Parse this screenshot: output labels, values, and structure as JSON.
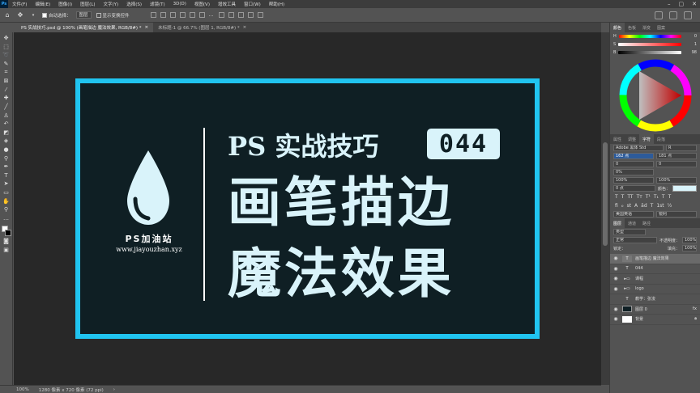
{
  "app": {
    "logo": "Ps"
  },
  "menu": [
    "文件(F)",
    "编辑(E)",
    "图像(I)",
    "图层(L)",
    "文字(Y)",
    "选择(S)",
    "滤镜(T)",
    "3D(D)",
    "视图(V)",
    "增效工具",
    "窗口(W)",
    "帮助(H)"
  ],
  "options": {
    "auto_select_label": "自动选择：",
    "auto_select_value": "图层",
    "show_transform_label": "显示变换控件"
  },
  "tabs": [
    {
      "label": "PS 实战技巧.psd @ 100% (画笔描边 魔法效果, RGB/8#) *",
      "close": "×"
    },
    {
      "label": "未标题-1 @ 66.7% (图层 1, RGB/8#) *",
      "close": "×"
    }
  ],
  "artwork": {
    "brand_name": "PS加油站",
    "brand_url": "www.jiayouzhan.xyz",
    "title_line1": "PS 实战技巧",
    "episode_number": "044",
    "title_line2": "画笔描边",
    "title_line3": "魔法效果",
    "colors": {
      "background": "#0f1f24",
      "frame": "#20c4f0",
      "text": "#d9f3fa"
    }
  },
  "status": {
    "zoom": "100%",
    "doc_size": "1280 像素 x 720 像素 (72 ppi)"
  },
  "color_panel": {
    "tabs": [
      "颜色",
      "色板",
      "渐变",
      "图案"
    ],
    "sliders": [
      {
        "label": "H",
        "value": "0"
      },
      {
        "label": "S",
        "value": "1"
      },
      {
        "label": "B",
        "value": "98"
      }
    ]
  },
  "props_tabs": [
    "属性",
    "调整",
    "字符",
    "段落"
  ],
  "character": {
    "font": "Adobe 黑体 Std",
    "style": "R",
    "size": "162 点",
    "leading": "181 点",
    "kerning": "0",
    "tracking": "0",
    "percent": "0%",
    "vscale": "100%",
    "hscale": "100%",
    "baseline": "0 点",
    "color_label": "颜色：",
    "lang": "美国英语",
    "aa": "锐利",
    "type_buttons": [
      "T",
      "T",
      "TT",
      "Tт",
      "T¹",
      "T₁",
      "T",
      "T"
    ],
    "otf_buttons": [
      "fi",
      "ℴ",
      "st",
      "A",
      "ād",
      "T",
      "1st",
      "½"
    ]
  },
  "layers_panel": {
    "tabs": [
      "图层",
      "通道",
      "路径"
    ],
    "filter": "类型",
    "blend": "正常",
    "opacity_label": "不透明度：",
    "opacity": "100%",
    "lock_label": "锁定：",
    "fill_label": "填充：",
    "fill": "100%",
    "layers": [
      {
        "name": "画笔描边 魔法效果",
        "thumb": "T",
        "active": true
      },
      {
        "name": "044",
        "thumb": "T",
        "active": false
      },
      {
        "name": "课程",
        "thumb": "▸▭",
        "active": false
      },
      {
        "name": "logo",
        "thumb": "▸▭",
        "active": false
      },
      {
        "name": "教学：张浚",
        "thumb": "T",
        "active": false
      },
      {
        "name": "图层 0",
        "thumb": "",
        "active": false
      },
      {
        "name": "背景",
        "thumb": "",
        "active": false
      }
    ]
  }
}
